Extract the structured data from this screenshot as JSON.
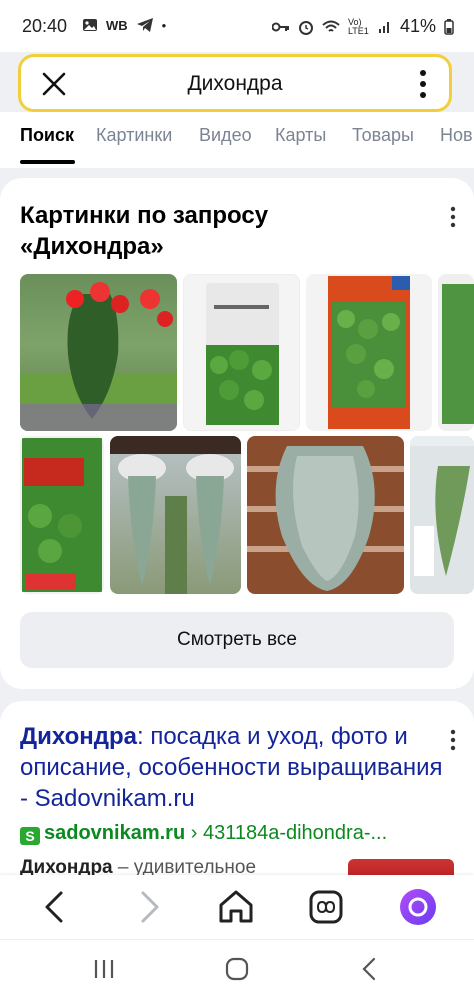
{
  "status_bar": {
    "time": "20:40",
    "battery": "41%",
    "wb": "WB",
    "network": "Vo) LTE1"
  },
  "search": {
    "query": "Дихондра"
  },
  "tabs": [
    "Поиск",
    "Картинки",
    "Видео",
    "Карты",
    "Товары",
    "Нов"
  ],
  "images_block": {
    "title": "Картинки по запросу «Дихондра»",
    "see_all": "Смотреть все"
  },
  "result": {
    "title_bold": "Дихондра",
    "title_rest": ": посадка и уход, фото и описание, особенности выращивания - Sadovnikam.ru",
    "favicon": "S",
    "domain": "sadovnikam.ru",
    "path": " › 431184a-dihondra-...",
    "snippet_bold": "Дихондра",
    "snippet_rest": " – удивительное"
  },
  "colors": {
    "accent_yellow": "#f2cf3a",
    "link_blue": "#14259a",
    "url_green": "#0a8a1f",
    "alice_purple": "#8a3cf5"
  }
}
